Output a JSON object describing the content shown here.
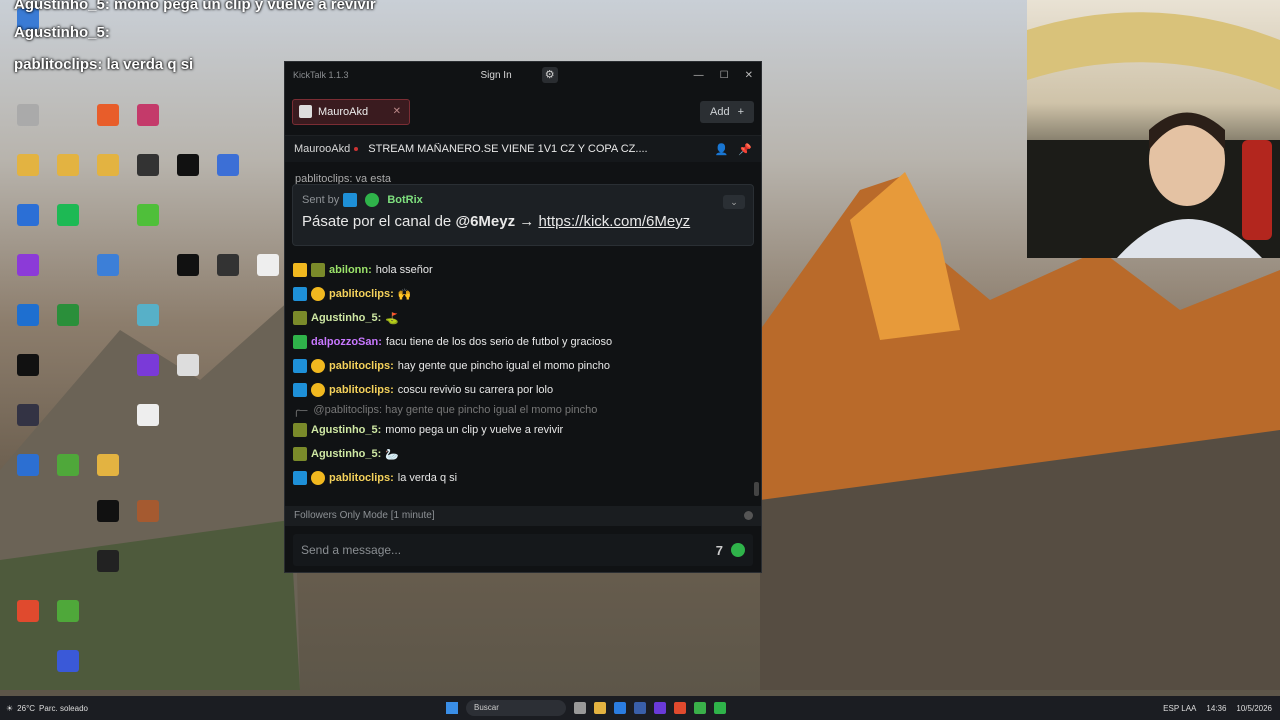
{
  "overlay": {
    "line1": "Agustinho_5: momo pega un clip y vuelve a revivir",
    "line2": "Agustinho_5:",
    "line3": "pablitoclips: la verda q si"
  },
  "app": {
    "title": "KickTalk 1.1.3",
    "sign_in": "Sign In",
    "tab_label": "MauroAkd",
    "add_label": "Add",
    "channel_name": "MaurooAkd",
    "stream_title": "STREAM MAÑANERO.SE VIENE 1V1 CZ Y COPA CZ....",
    "pinned": {
      "sent_by": "Sent by",
      "bot": "BotRix",
      "message_prefix": "Pásate por el canal de",
      "mention": "@6Meyz",
      "arrow": "→",
      "link": "https://kick.com/6Meyz"
    },
    "top_clip": "pablitoclips: va esta",
    "messages": [
      {
        "user": "abilonn:",
        "color": "grn",
        "text": "hola sseñor"
      },
      {
        "user": "pablitoclips:",
        "color": "yel",
        "text": "🙌"
      },
      {
        "user": "Agustinho_5:",
        "color": "lgr",
        "text": "⛳"
      },
      {
        "user": "dalpozzoSan:",
        "color": "pur",
        "text": "facu tiene de los dos serio de futbol y gracioso"
      },
      {
        "user": "pablitoclips:",
        "color": "yel",
        "text": "hay gente que pincho igual el momo pincho"
      },
      {
        "user": "pablitoclips:",
        "color": "yel",
        "text": "coscu revivio su carrera por lolo"
      }
    ],
    "reply_line": "@pablitoclips: hay gente que pincho igual el momo pincho",
    "messages2": [
      {
        "user": "Agustinho_5:",
        "color": "lgr",
        "text": "momo pega un clip y vuelve a revivir"
      },
      {
        "user": "Agustinho_5:",
        "color": "lgr",
        "text": "🦢"
      },
      {
        "user": "pablitoclips:",
        "color": "yel",
        "text": "la verda q si"
      }
    ],
    "followers_mode": "Followers Only Mode [1 minute]",
    "input_placeholder": "Send a message..."
  },
  "taskbar": {
    "temp": "26°C",
    "weather": "Parc. soleado",
    "search": "Buscar",
    "lang": "ESP LAA",
    "time": "14:36",
    "date": "10/5/2026"
  }
}
